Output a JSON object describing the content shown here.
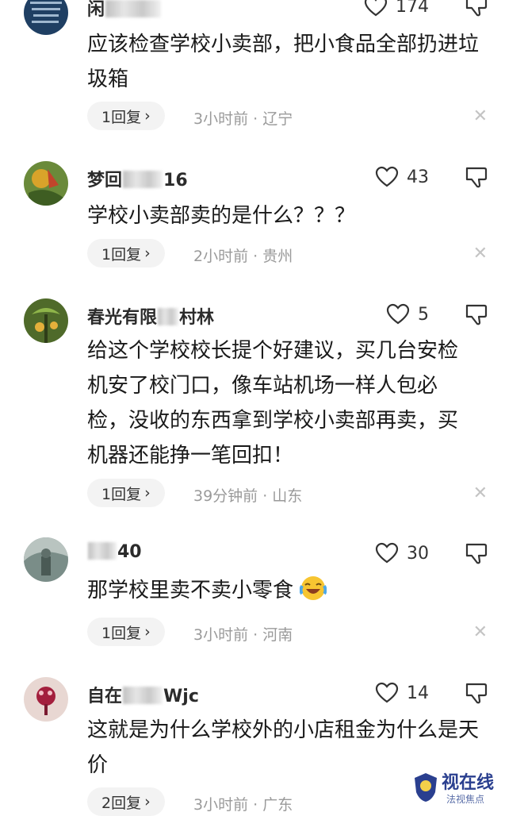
{
  "comments": [
    {
      "name_pre": "闲",
      "name_post": "",
      "likes": "174",
      "text": "应该检查学校小卖部，把小食品全部扔进垃圾箱",
      "reply": "1回复",
      "meta": "3小时前 · 辽宁"
    },
    {
      "name_pre": "梦回",
      "name_post": "16",
      "likes": "43",
      "text": "学校小卖部卖的是什么？？？",
      "reply": "1回复",
      "meta": "2小时前 · 贵州"
    },
    {
      "name_pre": "春光有限",
      "name_post": "村林",
      "likes": "5",
      "text": "给这个学校校长提个好建议，买几台安检机安了校门口，像车站机场一样人包必检，没收的东西拿到学校小卖部再卖，买机器还能挣一笔回扣！",
      "reply": "1回复",
      "meta": "39分钟前 · 山东"
    },
    {
      "name_pre": "",
      "name_post": "40",
      "likes": "30",
      "text": "那学校里卖不卖小零食",
      "reply": "1回复",
      "meta": "3小时前 · 河南"
    },
    {
      "name_pre": "自在",
      "name_post": "Wjc",
      "likes": "14",
      "text": "这就是为什么学校外的小店租金为什么是天价",
      "reply": "2回复",
      "meta": "3小时前 · 广东"
    }
  ],
  "icons": {
    "like": "heart-outline-icon",
    "dislike": "thumbs-down-outline-icon",
    "close": "close-icon",
    "reply_chevron": "chevron-right-icon",
    "emoji": "laughing-crying-emoji"
  },
  "watermark": {
    "text": "视在线",
    "subtext": "法视焦点"
  },
  "glyphs": {
    "chevron": "›",
    "close": "✕"
  }
}
